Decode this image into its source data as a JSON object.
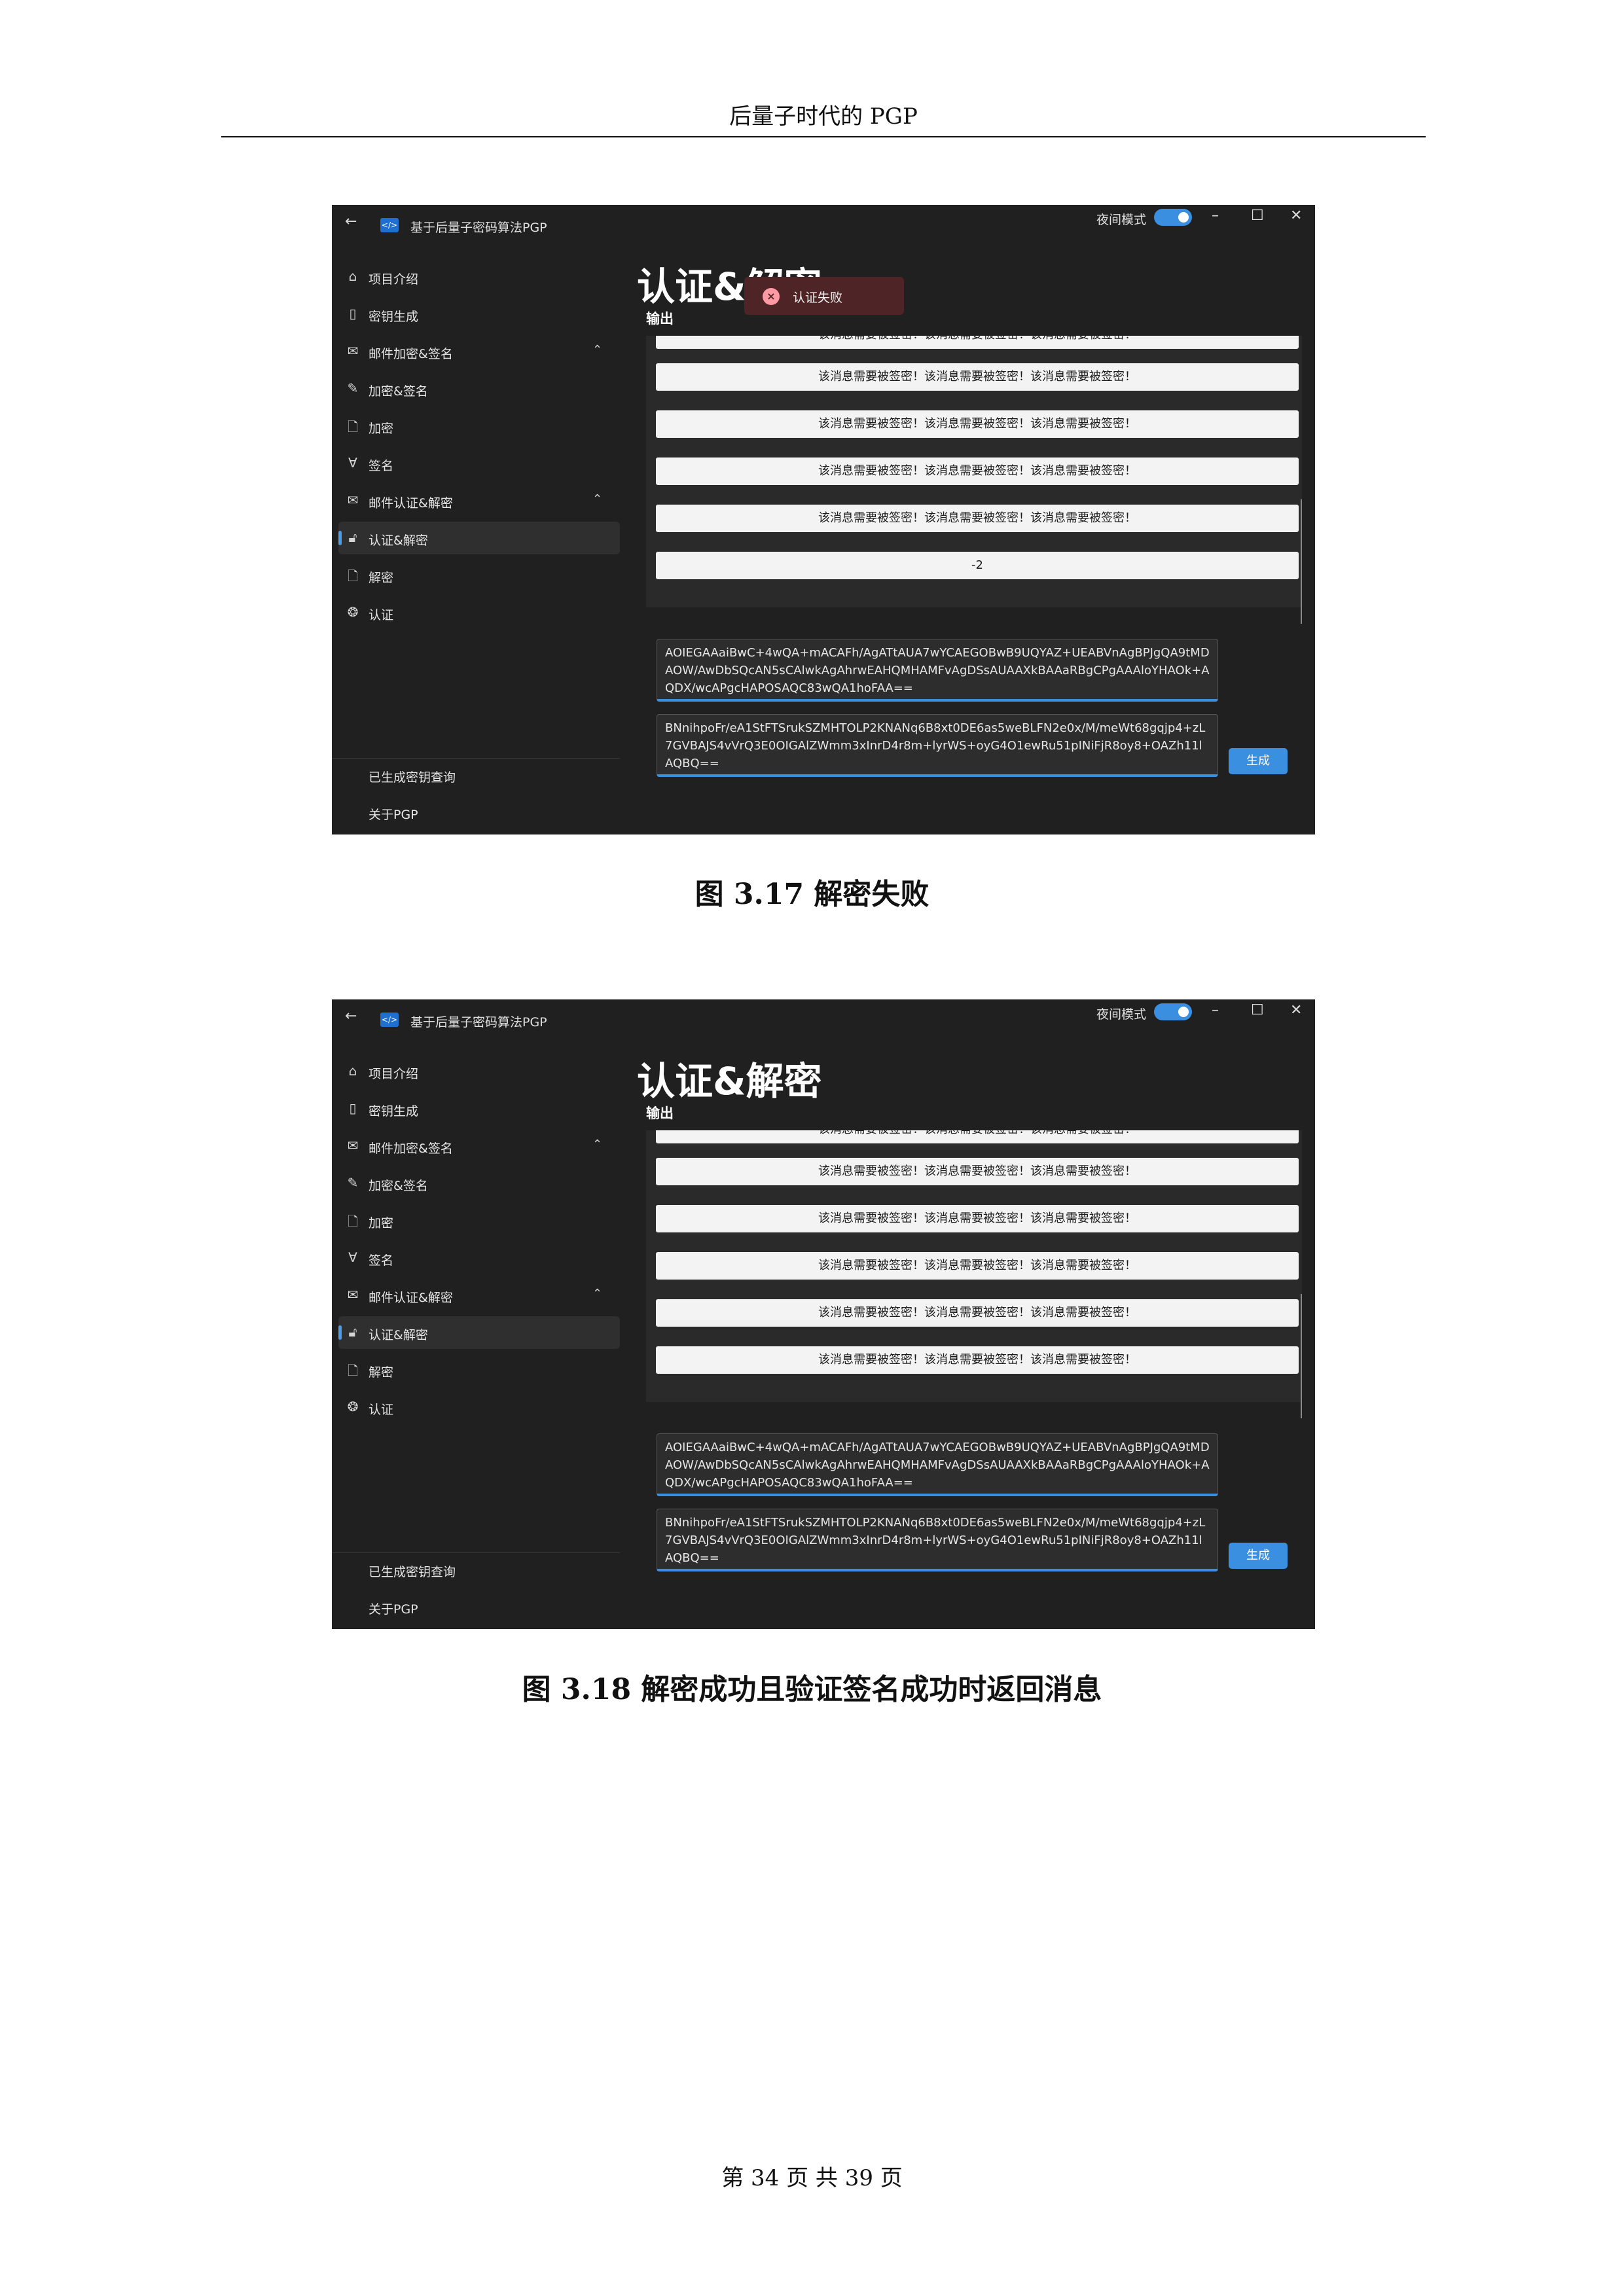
{
  "header": {
    "title": "后量子时代的 PGP"
  },
  "footer": {
    "text": "第 34 页   共 39 页"
  },
  "app": {
    "title": "基于后量子密码算法PGP",
    "night_mode_label": "夜间模式",
    "page_title": "认证&解密",
    "output_label": "输出",
    "generate_button": "生成",
    "nav": [
      {
        "label": "项目介绍",
        "icon": "home-icon"
      },
      {
        "label": "密钥生成",
        "icon": "key-document-icon"
      },
      {
        "label": "邮件加密&签名",
        "icon": "mail-lock-icon"
      },
      {
        "label": "加密&签名",
        "icon": "pen-sign-icon"
      },
      {
        "label": "加密",
        "icon": "lock-document-icon"
      },
      {
        "label": "签名",
        "icon": "signature-icon"
      },
      {
        "label": "邮件认证&解密",
        "icon": "mail-unlock-icon"
      },
      {
        "label": "认证&解密",
        "icon": "unlock-icon"
      },
      {
        "label": "解密",
        "icon": "document-icon"
      },
      {
        "label": "认证",
        "icon": "fingerprint-icon"
      }
    ],
    "nav_footer": [
      "已生成密钥查询",
      "关于PGP"
    ],
    "key_field_1": "AOIEGAAaiBwC+4wQA+mACAFh/AgATtAUA7wYCAEGOBwB9UQYAZ+UEABVnAgBPJgQA9tMDAOW/AwDbSQcAN5sCAlwkAgAhrwEAHQMHAMFvAgDSsAUAAXkBAAaRBgCPgAAAloYHAOk+AQDX/wcAPgcHAPOSAQC83wQA1hoFAA==",
    "key_field_2": "BNnihpoFr/eA1StFTSrukSZMHTOLP2KNANq6B8xt0DE6as5weBLFN2e0x/M/meWt68gqjp4+zL7GVBAJS4vVrQ3E0OIGAlZWmm3xInrD4r8m+lyrWS+oyG4O1ewRu51pINiFjR8oy8+OAZh11lAQBQ==",
    "screen_1": {
      "toast": "认证失败",
      "messages": [
        "该消息需要被签密！该消息需要被签密！该消息需要被签密！",
        "该消息需要被签密！该消息需要被签密！该消息需要被签密！",
        "该消息需要被签密！该消息需要被签密！该消息需要被签密！",
        "该消息需要被签密！该消息需要被签密！该消息需要被签密！",
        "该消息需要被签密！该消息需要被签密！该消息需要被签密！",
        "-2"
      ]
    },
    "screen_2": {
      "messages": [
        "该消息需要被签密！该消息需要被签密！该消息需要被签密！",
        "该消息需要被签密！该消息需要被签密！该消息需要被签密！",
        "该消息需要被签密！该消息需要被签密！该消息需要被签密！",
        "该消息需要被签密！该消息需要被签密！该消息需要被签密！",
        "该消息需要被签密！该消息需要被签密！该消息需要被签密！",
        "该消息需要被签密！该消息需要被签密！该消息需要被签密！"
      ]
    }
  },
  "captions": {
    "fig1": "图 3.17    解密失败",
    "fig2": "图 3.18    解密成功且验证签名成功时返回消息"
  }
}
